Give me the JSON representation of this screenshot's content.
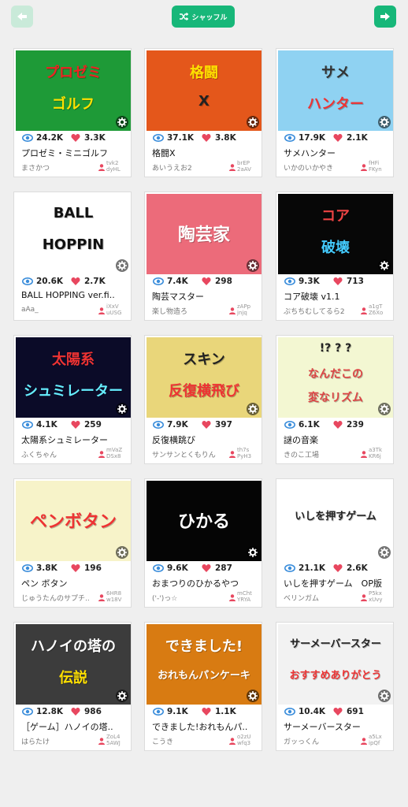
{
  "toolbar": {
    "back_icon": "arrow-left-icon",
    "forward_icon": "arrow-right-icon",
    "shuffle_icon": "shuffle-icon",
    "shuffle_label": "シャッフル",
    "accent_color": "#17b779",
    "accent_disabled": "#c9ead9"
  },
  "cards": [
    {
      "title": "プロゼミ・ミニゴルフ",
      "author": "まさかつ",
      "views": "24.2K",
      "likes": "3.3K",
      "code1": "tvk2",
      "code2": "dyHL",
      "thumb_lines": [
        "プロゼミ",
        "ゴルフ"
      ],
      "thumb_bg": "#1e9a37"
    },
    {
      "title": "格闘X",
      "author": "あいうえお2",
      "views": "37.1K",
      "likes": "3.8K",
      "code1": "brEP",
      "code2": "2aAV",
      "thumb_lines": [
        "格闘",
        "X"
      ],
      "thumb_bg": "#e4571b"
    },
    {
      "title": "サメハンター",
      "author": "いかのいかやき",
      "views": "17.9K",
      "likes": "2.1K",
      "code1": "fHFi",
      "code2": "FKyn",
      "thumb_lines": [
        "サメ",
        "ハンター"
      ],
      "thumb_bg": "#8fd2f2"
    },
    {
      "title": "BALL HOPPING ver.fi..",
      "author": "aAa_",
      "views": "20.6K",
      "likes": "2.7K",
      "code1": "iXxV",
      "code2": "uUSG",
      "thumb_lines": [
        "BALL",
        "HOPPIN"
      ],
      "thumb_bg": "#ffffff"
    },
    {
      "title": "陶芸マスター",
      "author": "楽し物造ろ",
      "views": "7.4K",
      "likes": "298",
      "code1": "zAPp",
      "code2": "jnjq",
      "thumb_lines": [
        "陶芸家"
      ],
      "thumb_bg": "#ec6b7a"
    },
    {
      "title": "コア破壊 v1.1",
      "author": "ぷちちむしてるら2",
      "views": "9.3K",
      "likes": "713",
      "code1": "a1gT",
      "code2": "Z6Xo",
      "thumb_lines": [
        "コア",
        "破壊"
      ],
      "thumb_bg": "#070707"
    },
    {
      "title": "太陽系シュミレーター",
      "author": "ふくちゃん",
      "views": "4.1K",
      "likes": "259",
      "code1": "mVaZ",
      "code2": "DSx8",
      "thumb_lines": [
        "太陽系",
        "シュミレーター"
      ],
      "thumb_bg": "#0b0b28"
    },
    {
      "title": "反復横跳び",
      "author": "サンサンとくもりん",
      "views": "7.9K",
      "likes": "397",
      "code1": "th7s",
      "code2": "PyH3",
      "thumb_lines": [
        "スキン",
        "反復横飛び"
      ],
      "thumb_bg": "#e9d67a"
    },
    {
      "title": "謎の音楽",
      "author": "きのこ工場",
      "views": "6.1K",
      "likes": "239",
      "code1": "a3Tk",
      "code2": "KR6j",
      "thumb_lines": [
        "!? ? ?",
        "なんだこの",
        "変なリズム"
      ],
      "thumb_bg": "#f3f7d2"
    },
    {
      "title": "ペン ボタン",
      "author": "じゅうたんのサプチ..",
      "views": "3.8K",
      "likes": "196",
      "code1": "6HR8",
      "code2": "w18V",
      "thumb_lines": [
        "ペンボタン"
      ],
      "thumb_bg": "#f7f3c9"
    },
    {
      "title": "おまつりのひかるやつ",
      "author": "('-')っ☆",
      "views": "9.6K",
      "likes": "287",
      "code1": "mCht",
      "code2": "YRYA",
      "thumb_lines": [
        "ひかる"
      ],
      "thumb_bg": "#050505"
    },
    {
      "title": "いしを押すゲーム　OP版",
      "author": "ベリンガム",
      "views": "21.1K",
      "likes": "2.6K",
      "code1": "P5kx",
      "code2": "xUvy",
      "thumb_lines": [
        "いしを押すゲーム"
      ],
      "thumb_bg": "#ffffff"
    },
    {
      "title": "［ゲーム］ハノイの塔..",
      "author": "はらたけ",
      "views": "12.8K",
      "likes": "986",
      "code1": "ZoL4",
      "code2": "5AWJ",
      "thumb_lines": [
        "ハノイの塔の",
        "伝説"
      ],
      "thumb_bg": "#3c3c3c"
    },
    {
      "title": "できました!おれもんパ..",
      "author": "こうき",
      "views": "9.1K",
      "likes": "1.1K",
      "code1": "o2zU",
      "code2": "wfq3",
      "thumb_lines": [
        "できました!",
        "おれもんパンケーキ"
      ],
      "thumb_bg": "#d87b12"
    },
    {
      "title": "サーメーバースター",
      "author": "ガッっくん",
      "views": "10.4K",
      "likes": "691",
      "code1": "a5Lx",
      "code2": "ipQf",
      "thumb_lines": [
        "サーメーバースター",
        "おすすめありがとう"
      ],
      "thumb_bg": "#f2f2f2"
    }
  ],
  "icons": {
    "views": "eye-icon",
    "likes": "heart-icon",
    "settings": "gear-icon",
    "user": "user-icon"
  },
  "colors": {
    "eye": "#3a8ddb",
    "heart": "#e8475f",
    "user": "#e8475f"
  }
}
